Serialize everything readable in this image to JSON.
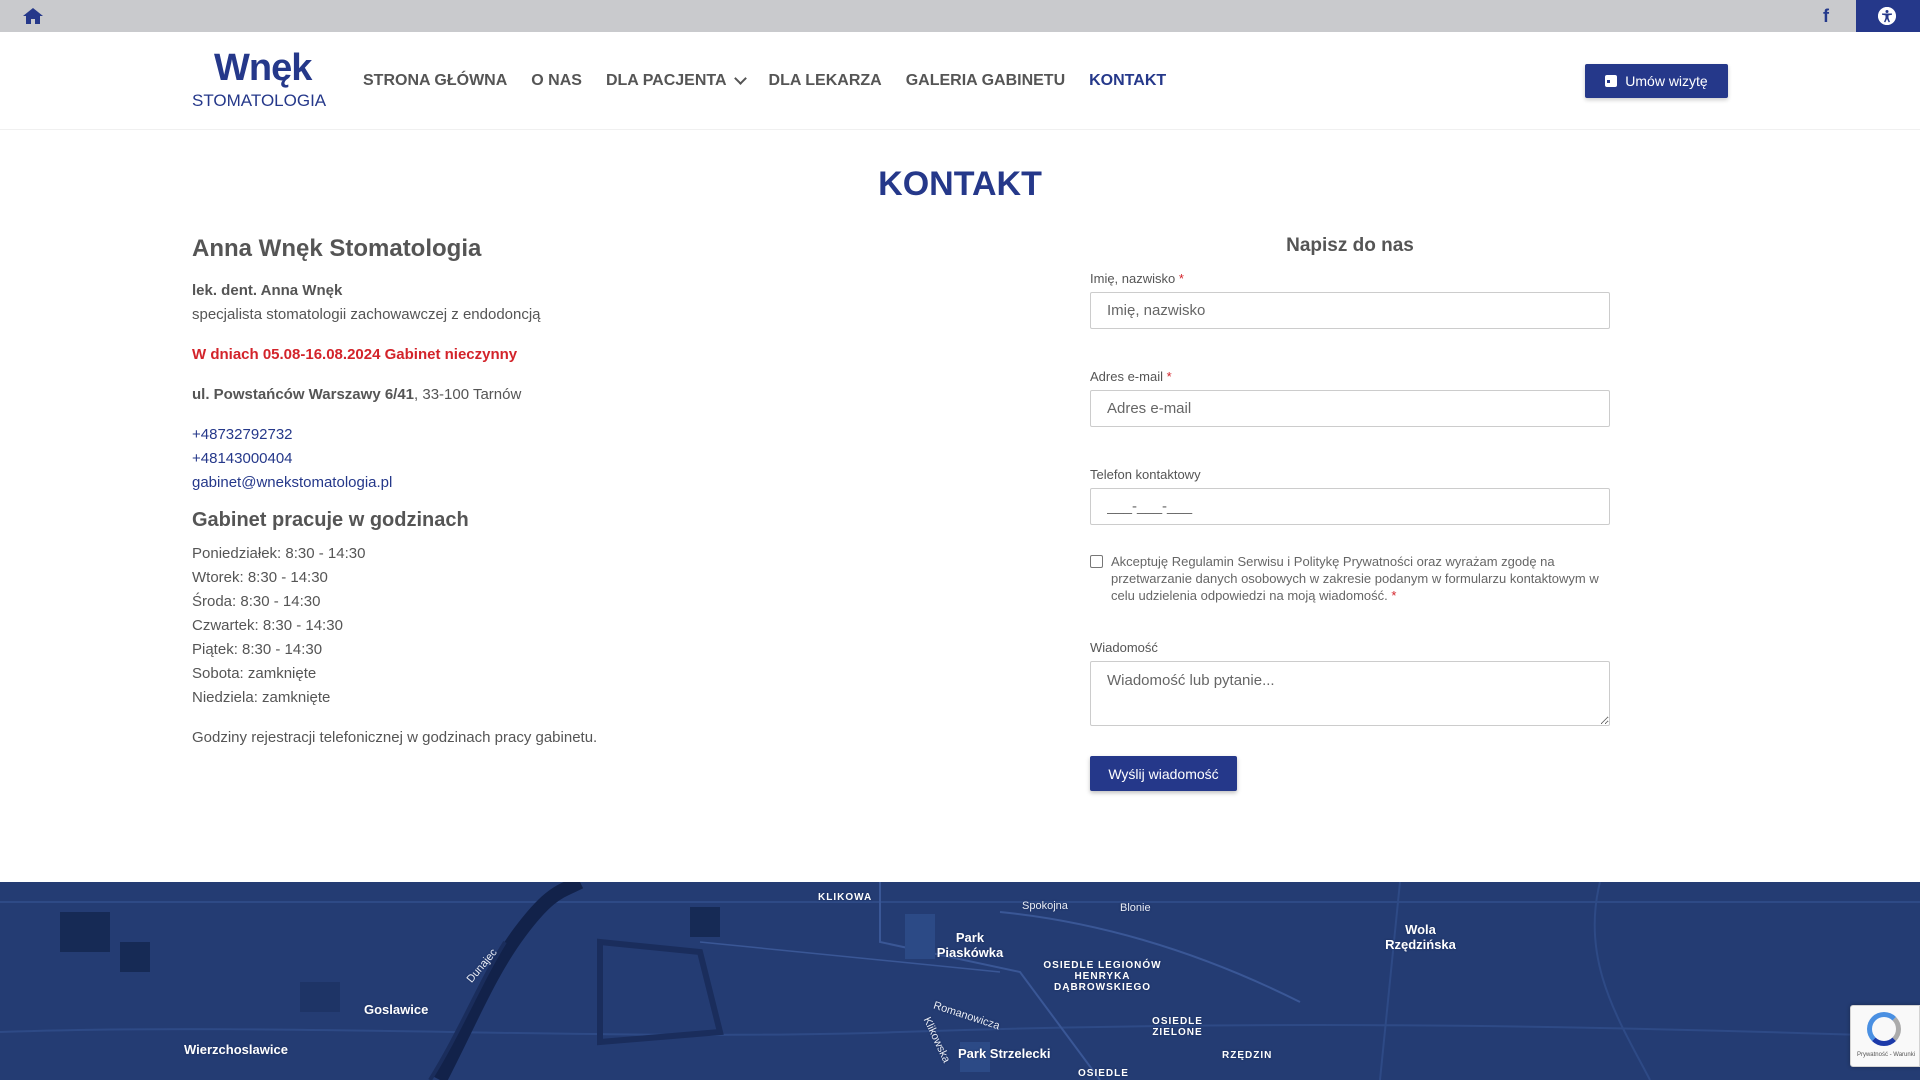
{
  "topbar": {
    "home_icon": "home-icon",
    "facebook_icon": "f",
    "accessibility_icon": "accessibility-icon"
  },
  "header": {
    "logo_main": "Wnęk",
    "logo_sub": "STOMATOLOGIA",
    "nav": [
      {
        "label": "STRONA GŁÓWNA"
      },
      {
        "label": "O NAS"
      },
      {
        "label": "DLA PACJENTA"
      },
      {
        "label": "DLA LEKARZA"
      },
      {
        "label": "GALERIA GABINETU"
      },
      {
        "label": "KONTAKT"
      }
    ],
    "cta_label": "Umów wizytę"
  },
  "page_title": "KONTAKT",
  "contact": {
    "clinic_name": "Anna Wnęk Stomatologia",
    "doctor_name": "lek. dent. Anna Wnęk",
    "doctor_spec": "specjalista stomatologii zachowawczej z endodoncją",
    "notice": "W dniach 05.08-16.08.2024 Gabinet nieczynny",
    "street": "ul. Powstańców Warszawy 6/41",
    "city": ", 33-100 Tarnów",
    "phone1": "+48732792732",
    "phone2": "+48143000404",
    "email": "gabinet@wnekstomatologia.pl",
    "hours_title": "Gabinet pracuje w godzinach",
    "hours": [
      "Poniedziałek: 8:30 - 14:30",
      "Wtorek: 8:30 - 14:30",
      "Środa: 8:30 - 14:30",
      "Czwartek: 8:30 - 14:30",
      "Piątek: 8:30 - 14:30",
      "Sobota: zamknięte",
      "Niedziela: zamknięte"
    ],
    "phone_note": "Godziny rejestracji telefonicznej w godzinach pracy gabinetu."
  },
  "form": {
    "title": "Napisz do nas",
    "name_label": "Imię, nazwisko",
    "name_placeholder": "Imię, nazwisko",
    "email_label": "Adres e-mail",
    "email_placeholder": "Adres e-mail",
    "phone_label": "Telefon kontaktowy",
    "phone_placeholder": "___-___-___",
    "required_mark": "*",
    "consent_text": "Akceptuję Regulamin Serwisu i Politykę Prywatności oraz wyrażam zgodę na przetwarzanie danych osobowych w zakresie podanym w formularzu kontaktowym w celu udzielenia odpowiedzi na moją wiadomość.",
    "message_label": "Wiadomość",
    "message_placeholder": "Wiadomość lub pytanie...",
    "submit_label": "Wyślij wiadomość"
  },
  "map": {
    "labels": [
      "KLIKOWA",
      "Spokojna",
      "Blonie",
      "Park Piaskówka",
      "OSIEDLE LEGIONÓW HENRYKA DĄBROWSKIEGO",
      "Wola Rzędzińska",
      "Dunajec",
      "Goslawice",
      "Romanowicza",
      "Klikowska",
      "OSIEDLE ZIELONE",
      "Wierzchoslawice",
      "Park Strzelecki",
      "RZĘDZIN",
      "OSIEDLE"
    ]
  },
  "recaptcha": {
    "text": "Prywatność - Warunki"
  },
  "colors": {
    "brand": "#25388a",
    "notice": "#d3232a",
    "map": "#243c73"
  }
}
